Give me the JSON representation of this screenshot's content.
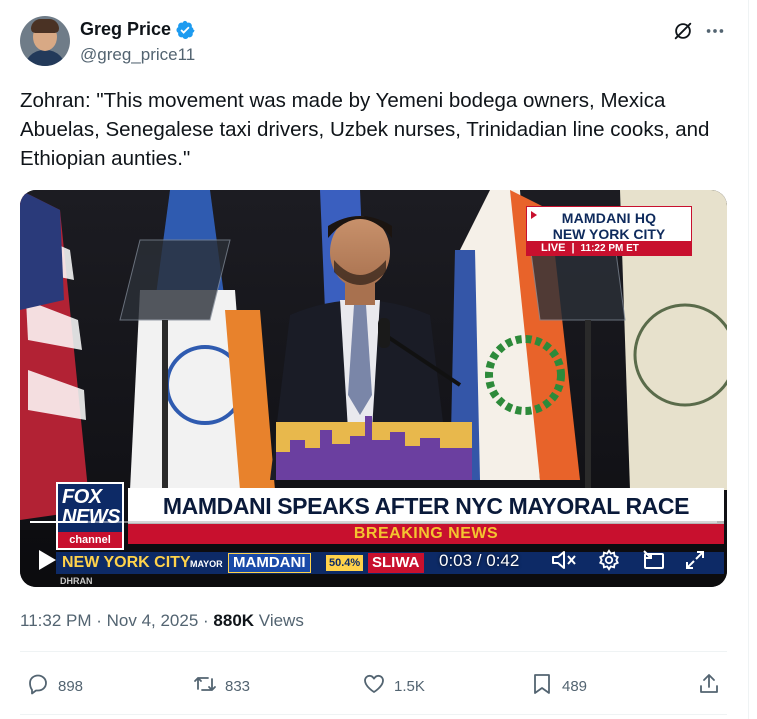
{
  "author": {
    "display_name": "Greg Price",
    "handle": "@greg_price11",
    "verified": true
  },
  "tweet": {
    "text": "Zohran: \"This movement was made by Yemeni bodega owners, Mexica Abuelas, Senegalese taxi drivers, Uzbek nurses, Trinidadian line cooks, and Ethiopian aunties.\""
  },
  "video": {
    "hq_box": {
      "line1": "MAMDANI HQ",
      "line2": "NEW YORK CITY",
      "live": "LIVE",
      "time": "11:22 PM ET"
    },
    "network": {
      "fox": "FOX",
      "news": "NEWS",
      "channel": "channel"
    },
    "headline": "MAMDANI SPEAKS AFTER NYC MAYORAL RACE VICTORY",
    "breaking": "BREAKING NEWS",
    "ticker": {
      "city": "NEW YORK CITY",
      "race": "MAYOR",
      "candidate1": "MAMDANI",
      "candidate1_pct": "50.4%",
      "candidate2": "SLIWA"
    },
    "bottom_fragment": "DHRAN",
    "player": {
      "current_time": "0:03",
      "duration": "0:42",
      "time_display": "0:03 / 0:42",
      "progress_fraction": 0.071
    }
  },
  "meta": {
    "time": "11:32 PM",
    "date": "Nov 4, 2025",
    "separator": " · ",
    "views_count": "880K",
    "views_label": "Views"
  },
  "actions": {
    "replies": "898",
    "reposts": "833",
    "likes": "1.5K",
    "bookmarks": "489"
  },
  "icons": {
    "verified": "verified-badge-icon",
    "grok": "grok-icon",
    "more": "more-horizontal-icon",
    "play": "play-icon",
    "mute": "mute-icon",
    "settings": "settings-gear-icon",
    "pip": "picture-in-picture-icon",
    "fullscreen": "fullscreen-icon",
    "reply": "reply-icon",
    "repost": "repost-icon",
    "like": "heart-icon",
    "bookmark": "bookmark-icon",
    "share": "share-icon"
  },
  "colors": {
    "text_primary": "#0f1419",
    "text_secondary": "#536471",
    "verified_blue": "#1d9bf0",
    "fox_red": "#c8102e",
    "fox_navy": "#0d2a66",
    "ticker_gold": "#ffd24a"
  }
}
